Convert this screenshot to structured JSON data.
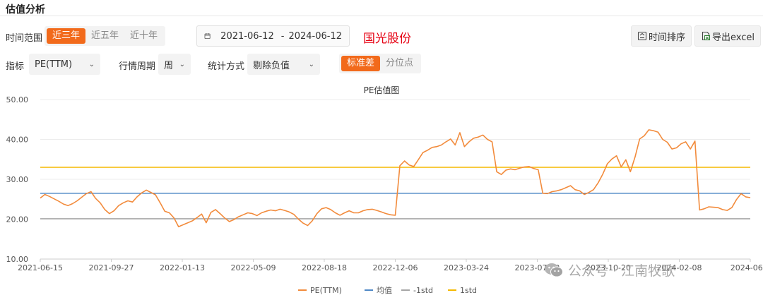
{
  "panel": {
    "title": "估值分析"
  },
  "filters": {
    "time_range_label": "时间范围",
    "time_range_options": [
      "近三年",
      "近五年",
      "近十年"
    ],
    "time_range_active": 0,
    "date_start": "2021-06-12",
    "date_sep": "-",
    "date_end": "2024-06-12",
    "stock_name": "国光股份",
    "metric_label": "指标",
    "metric_value": "PE(TTM)",
    "period_label": "行情周期",
    "period_value": "周",
    "stat_label": "统计方式",
    "stat_value": "剔除负值",
    "mode_options": [
      "标准差",
      "分位点"
    ],
    "mode_active": 0
  },
  "toolbar": {
    "sort_label": "时间排序",
    "export_label": "导出excel"
  },
  "watermark": {
    "text": "公众号 · 江南牧歌"
  },
  "chart_data": {
    "type": "line",
    "title": "PE估值图",
    "ylim": [
      10,
      50
    ],
    "yticks": [
      "10.00",
      "20.00",
      "30.00",
      "40.00",
      "50.00"
    ],
    "xtick_labels": [
      "2021-06-15",
      "2021-09-27",
      "2022-01-13",
      "2022-05-09",
      "2022-08-18",
      "2022-12-06",
      "2023-03-24",
      "2023-07-12",
      "2023-10-20",
      "2024-02-08",
      "2024-06..."
    ],
    "legend_position": "bottom",
    "grid": true,
    "colors": {
      "pe": "#f28b3c",
      "mean": "#4f88c6",
      "minus1": "#a6a6a6",
      "plus1": "#f5b800"
    },
    "series": [
      {
        "name": "PE(TTM)",
        "values": [
          25.3,
          26.2,
          25.7,
          25.1,
          24.5,
          23.8,
          23.4,
          23.9,
          24.6,
          25.5,
          26.4,
          26.9,
          25.2,
          24.1,
          22.4,
          21.4,
          22.1,
          23.4,
          24.1,
          24.6,
          24.3,
          25.6,
          26.6,
          27.3,
          26.7,
          26.1,
          24.1,
          22.0,
          21.6,
          20.3,
          18.1,
          18.6,
          19.1,
          19.6,
          20.4,
          21.3,
          19.1,
          21.7,
          22.4,
          21.4,
          20.3,
          19.4,
          19.9,
          20.6,
          21.1,
          21.6,
          21.4,
          20.9,
          21.6,
          22.0,
          22.3,
          22.1,
          22.5,
          22.2,
          21.8,
          21.2,
          20.0,
          19.0,
          18.4,
          19.6,
          21.4,
          22.6,
          22.9,
          22.4,
          21.6,
          21.0,
          21.6,
          22.1,
          21.6,
          21.6,
          22.1,
          22.4,
          22.5,
          22.2,
          21.8,
          21.4,
          21.1,
          21.0,
          33.4,
          34.6,
          33.6,
          33.2,
          34.9,
          36.7,
          37.3,
          38.0,
          38.2,
          38.6,
          39.4,
          40.1,
          38.6,
          41.7,
          38.2,
          39.4,
          40.3,
          40.6,
          41.1,
          40.0,
          39.4,
          31.9,
          31.2,
          32.3,
          32.6,
          32.4,
          32.8,
          33.1,
          33.2,
          32.7,
          32.4,
          26.5,
          26.4,
          26.9,
          27.1,
          27.4,
          27.9,
          28.4,
          27.4,
          27.1,
          26.2,
          26.7,
          27.4,
          29.1,
          31.3,
          33.9,
          35.1,
          35.9,
          33.1,
          34.9,
          31.9,
          35.6,
          40.1,
          40.9,
          42.4,
          42.2,
          41.8,
          40.0,
          39.3,
          37.6,
          37.9,
          38.9,
          39.4,
          37.6,
          39.6,
          22.3,
          22.6,
          23.1,
          23.0,
          22.9,
          22.4,
          22.2,
          22.9,
          24.9,
          26.4,
          25.6,
          25.4
        ]
      },
      {
        "name": "均值",
        "values": [
          26.5
        ]
      },
      {
        "name": "-1std",
        "values": [
          20.1
        ]
      },
      {
        "name": "1std",
        "values": [
          33.0
        ]
      }
    ]
  }
}
